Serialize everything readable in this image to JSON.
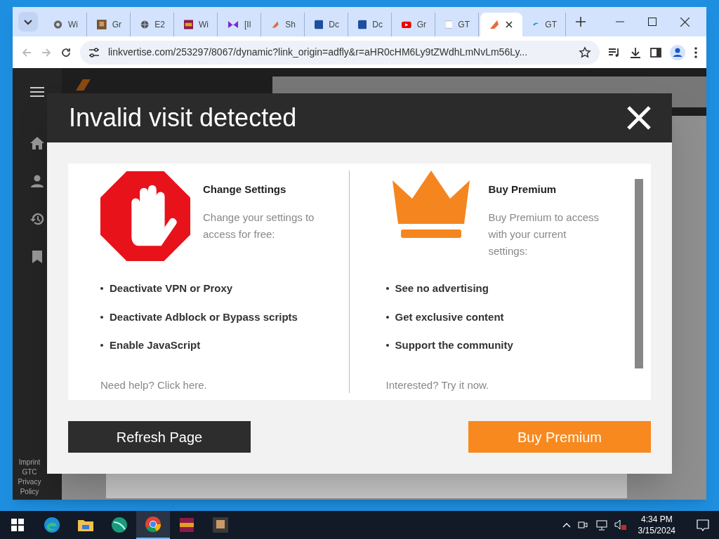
{
  "browser": {
    "tabs": [
      {
        "title": "Wi",
        "kind": "chrome",
        "selected": false
      },
      {
        "title": "Gr",
        "kind": "avatar",
        "selected": false
      },
      {
        "title": "E2",
        "kind": "globe",
        "selected": false
      },
      {
        "title": "Wi",
        "kind": "archive",
        "selected": false
      },
      {
        "title": "[Il",
        "kind": "purple",
        "selected": false
      },
      {
        "title": "Sh",
        "kind": "orange",
        "selected": false
      },
      {
        "title": "Dc",
        "kind": "square",
        "selected": false
      },
      {
        "title": "Dc",
        "kind": "square",
        "selected": false
      },
      {
        "title": "Gr",
        "kind": "video",
        "selected": false
      },
      {
        "title": "GT",
        "kind": "plain",
        "selected": false
      },
      {
        "kind": "orange",
        "selected": true
      },
      {
        "title": "GT",
        "kind": "swirl",
        "selected": false
      }
    ],
    "address": "linkvertise.com/253297/8067/dynamic?link_origin=adfly&r=aHR0cHM6Ly9tZWdhLmNvLm56Ly..."
  },
  "sidebar": {
    "footer_links": [
      "Imprint",
      "GTC",
      "Privacy Policy"
    ]
  },
  "modal": {
    "title": "Invalid visit detected",
    "columns": [
      {
        "kind": "stop",
        "heading": "Change Settings",
        "description": "Change your settings to access for free:",
        "bullets": [
          "Deactivate VPN or Proxy",
          "Deactivate Adblock or Bypass scripts",
          "Enable JavaScript"
        ],
        "footer": "Need help? Click here."
      },
      {
        "kind": "crown",
        "heading": "Buy Premium",
        "description": "Buy Premium to access with your current settings:",
        "bullets": [
          "See no advertising",
          "Get exclusive content",
          "Support the community"
        ],
        "footer": "Interested? Try it now."
      }
    ],
    "buttons": [
      {
        "label": "Refresh Page",
        "kind": "secondary"
      },
      {
        "label": "Buy Premium",
        "kind": "primary"
      }
    ]
  },
  "taskbar": {
    "apps": [
      {
        "kind": "edge",
        "selected": false
      },
      {
        "kind": "folder",
        "selected": false
      },
      {
        "kind": "sphere",
        "selected": false
      },
      {
        "kind": "chrome",
        "selected": true
      },
      {
        "kind": "archive",
        "selected": false
      },
      {
        "kind": "avatar",
        "selected": false
      }
    ],
    "time": "4:34 PM",
    "date": "3/15/2024"
  }
}
